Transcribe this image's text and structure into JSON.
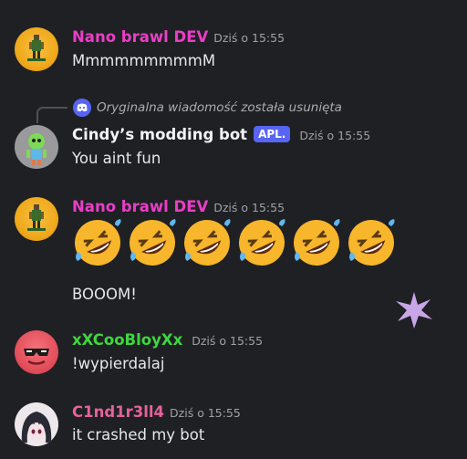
{
  "messages": [
    {
      "username": "Nano brawl DEV",
      "username_color": "#ea3ec6",
      "timestamp": "Dziś o 15:55",
      "text": "MmmmmmmmmM",
      "avatar": "avatar-orange-figure"
    },
    {
      "reply_note": "Oryginalna wiadomość została usunięta",
      "username": "Cindy’s modding bot",
      "username_color": "#f2f3f5",
      "tag": "APL.",
      "timestamp": "Dziś o 15:55",
      "text": "You aint fun",
      "avatar": "avatar-green-robot"
    },
    {
      "username": "Nano brawl DEV",
      "username_color": "#ea3ec6",
      "timestamp": "Dziś o 15:55",
      "emoji": "rolling-on-the-floor-laughing",
      "emoji_count": 6,
      "text": "BOOOM!",
      "avatar": "avatar-orange-figure"
    },
    {
      "username": "xXCooBloyXx",
      "username_color": "#3fd63f",
      "timestamp": "Dziś o 15:55",
      "text": "!wypierdalaj",
      "avatar": "avatar-red-sunglasses"
    },
    {
      "username": "C1nd1r3ll4",
      "username_color": "#e5629b",
      "timestamp": "Dziś o 15:55",
      "text": "it crashed my bot",
      "avatar": "avatar-anime-girl"
    }
  ],
  "colors": {
    "background": "#1f2024",
    "text": "#e6e7e9",
    "timestamp": "#9ea2a8",
    "app_tag": "#5865f2",
    "sparkle": "#c9a6e8"
  }
}
